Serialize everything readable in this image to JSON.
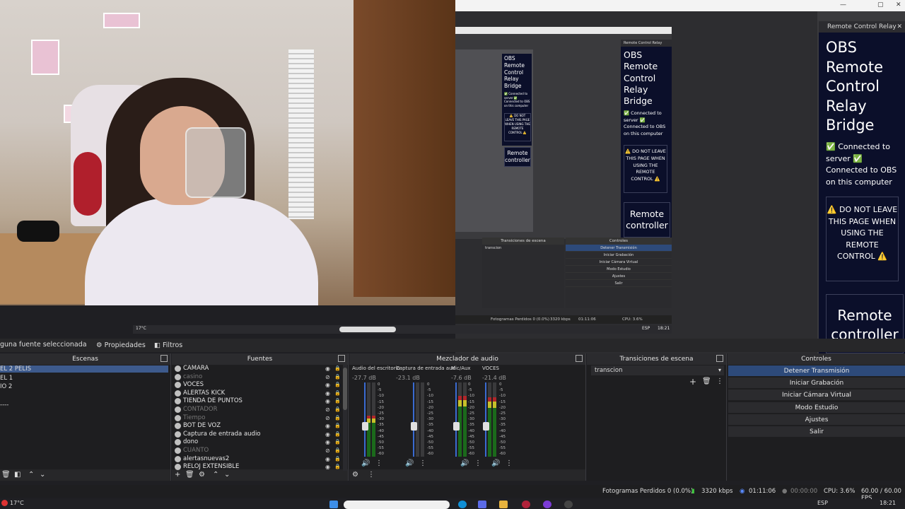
{
  "remote_panel": {
    "header": "Remote Control Relay",
    "title": "OBS Remote Control Relay Bridge",
    "status_server": "✅ Connected to server ✅",
    "status_obs": "Connected to OBS on this computer",
    "warning": "⚠️ DO NOT LEAVE THIS PAGE WHEN USING THE REMOTE CONTROL ⚠️",
    "button": "Remote controller"
  },
  "toolbar": {
    "no_source": "guna fuente seleccionada",
    "properties_label": "Propiedades",
    "filters_label": "Filtros"
  },
  "docks": {
    "scenes_title": "Escenas",
    "sources_title": "Fuentes",
    "mixer_title": "Mezclador de audio",
    "transitions_title": "Transiciones de escena",
    "controls_title": "Controles"
  },
  "scenes": [
    {
      "label": "EL 2 PELIS",
      "selected": true
    },
    {
      "label": "EL 1",
      "selected": false
    },
    {
      "label": "IO 2",
      "selected": false
    },
    {
      "label": "----",
      "selected": false
    }
  ],
  "sources": [
    {
      "label": "CAMARA",
      "visible": true
    },
    {
      "label": "casino",
      "visible": false
    },
    {
      "label": "VOCES",
      "visible": true
    },
    {
      "label": "ALERTAS KICK",
      "visible": true
    },
    {
      "label": "TIENDA DE PUNTOS",
      "visible": true
    },
    {
      "label": "CONTADOR",
      "visible": false
    },
    {
      "label": "Tiempo",
      "visible": false
    },
    {
      "label": "BOT DE VOZ",
      "visible": true
    },
    {
      "label": "Captura de entrada audio",
      "visible": true
    },
    {
      "label": "dono",
      "visible": true
    },
    {
      "label": "CUANTO",
      "visible": false
    },
    {
      "label": "alertasnuevas2",
      "visible": true
    },
    {
      "label": "RELOJ EXTENSIBLE",
      "visible": true
    }
  ],
  "mixer": [
    {
      "label": "Audio del escritorio",
      "db": "-27.7 dB",
      "level": 0.55
    },
    {
      "label": "Captura de entrada aud",
      "db": "-23.1 dB",
      "level": 0.0
    },
    {
      "label": "Mic/Aux",
      "db": "-7.6 dB",
      "level": 0.82
    },
    {
      "label": "VOCES",
      "db": "-21.4 dB",
      "level": 0.8
    }
  ],
  "mixer_scale": [
    "0",
    "-5",
    "-10",
    "-15",
    "-20",
    "-25",
    "-30",
    "-35",
    "-40",
    "-45",
    "-50",
    "-55",
    "-60"
  ],
  "transition": {
    "selected": "transcion"
  },
  "controls": [
    {
      "label": "Detener Transmisión",
      "active": true
    },
    {
      "label": "Iniciar Grabación",
      "active": false
    },
    {
      "label": "Iniciar Cámara Virtual",
      "active": false
    },
    {
      "label": "Modo Estudio",
      "active": false
    },
    {
      "label": "Ajustes",
      "active": false
    },
    {
      "label": "Salir",
      "active": false
    }
  ],
  "status": {
    "dropped": "Fotogramas Perdidos 0 (0.0%)",
    "bitrate": "3320 kbps",
    "stream_time": "01:11:06",
    "rec_time": "00:00:00",
    "cpu": "CPU: 3.6%",
    "fps": "60.00 / 60.00 FPS"
  },
  "taskbar": {
    "weather": "17°C",
    "lang": "ESP",
    "clock": "18:21"
  },
  "colors": {
    "accent": "#3d5a8c",
    "panel_bg": "#0b0f2a",
    "meter_green": "#1b6a1b"
  }
}
